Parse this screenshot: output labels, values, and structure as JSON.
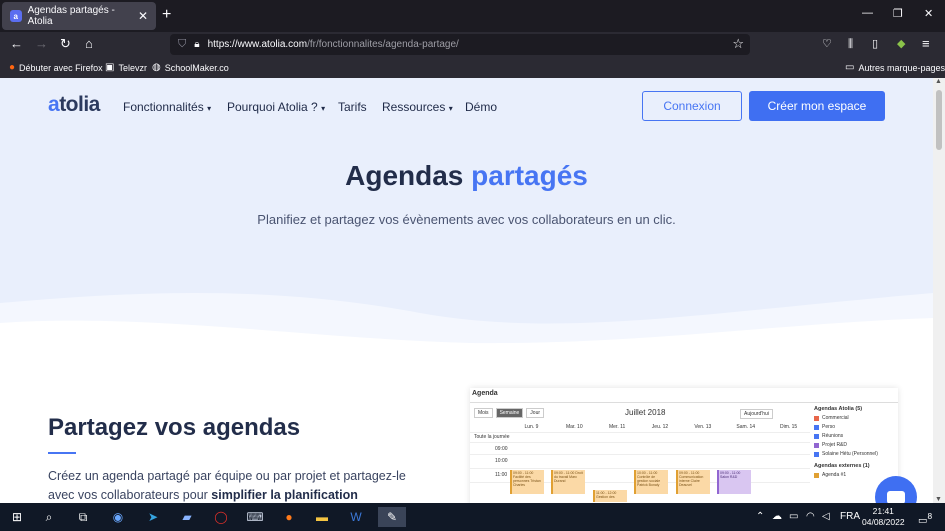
{
  "browser": {
    "tab_title": "Agendas partagés - Atolia",
    "tab_favicon": "a",
    "url_host": "https://www.atolia.com",
    "url_path": "/fr/fonctionnalites/agenda-partage/",
    "bookmarks": [
      "Débuter avec Firefox",
      "Televzr",
      "SchoolMaker.co"
    ],
    "other_bookmarks": "Autres marque-pages"
  },
  "site": {
    "logo_a": "a",
    "logo_rest": "tolia",
    "nav": [
      "Fonctionnalités",
      "Pourquoi Atolia ?",
      "Tarifs",
      "Ressources",
      "Démo"
    ],
    "login": "Connexion",
    "cta": "Créer mon espace",
    "accent_color": "#4775f3"
  },
  "hero": {
    "title_1": "Agendas",
    "title_2": "partagés",
    "subtitle": "Planifiez et partagez vos évènements avec vos collaborateurs en un clic."
  },
  "section": {
    "heading": "Partagez vos agendas",
    "para_1": "Créez un agenda partagé par équipe ou par projet et partagez-le avec vos collaborateurs pour ",
    "para_bold": "simplifier la planification"
  },
  "calendar": {
    "title": "Agenda",
    "views": [
      "Mois",
      "Semaine",
      "Jour"
    ],
    "month": "Juillet 2018",
    "today": "Aujourd'hui",
    "days": [
      "Lun. 9",
      "Mar. 10",
      "Mer. 11",
      "Jeu. 12",
      "Ven. 13",
      "Sam. 14",
      "Dim. 15"
    ],
    "allday": "Toute la journée",
    "times": [
      "09:00",
      "10:00",
      "11:00"
    ],
    "events": [
      "09:00 - 11:00 Facilité des personnes Tristan Charles",
      "09:00 - 11:00 Droit du travail Marc Durand",
      "10:00 - 11:00 Contrôle de gestion sociale Patrick Bonaly",
      "09:00 - 11:00 Communication interne Claire Deauvel",
      "09:00 - 11:00 Salon R&D",
      "11:00 - 12:00 Gestion des"
    ],
    "side_title": "Agendas Atolia",
    "side_count": "(5)",
    "agendas": [
      {
        "label": "Commercial",
        "color": "#e8664a"
      },
      {
        "label": "Perso",
        "color": "#4775f3"
      },
      {
        "label": "Réunions",
        "color": "#4775f3"
      },
      {
        "label": "Projet R&D",
        "color": "#9166d1"
      },
      {
        "label": "Solaine Hétu (Personnel)",
        "color": "#4775f3"
      }
    ],
    "external_title": "Agendas externes",
    "external_count": "(1)",
    "external": [
      {
        "label": "Agenda #1",
        "color": "#e0a033"
      }
    ]
  },
  "taskbar": {
    "lang": "FRA",
    "time": "21:41",
    "date": "04/08/2022",
    "notifications": "8"
  }
}
